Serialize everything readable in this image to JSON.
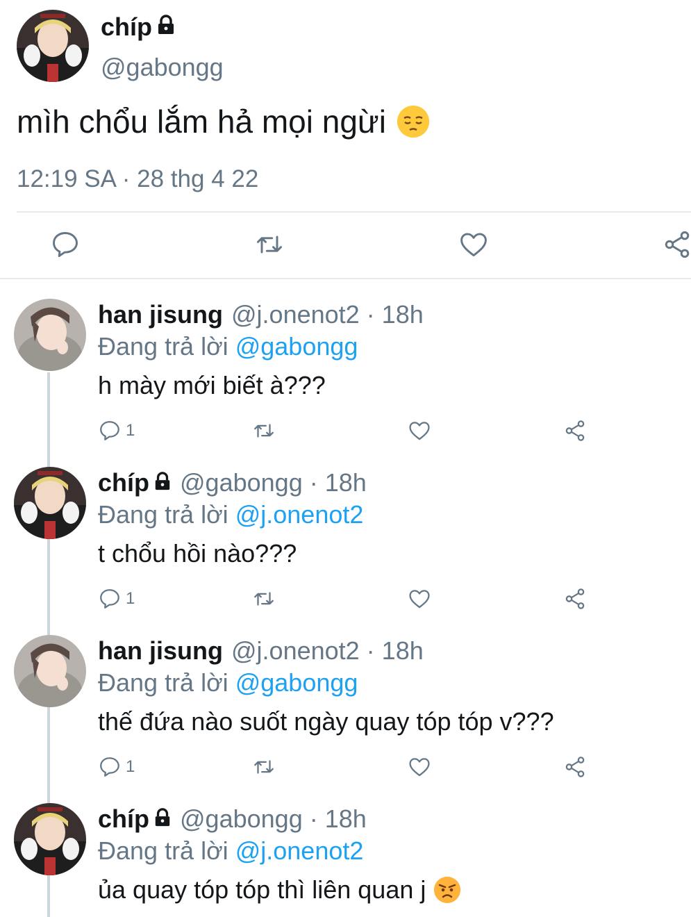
{
  "main_tweet": {
    "name": "chíp",
    "handle": "@gabongg",
    "text": "mìh chổu lắm hả mọi ngừi",
    "emoji": "pensive-face",
    "timestamp": "12:19 SA · 28 thg 4 22"
  },
  "replies": [
    {
      "name": "han jisung",
      "handle": "@j.onenot2 · 18h",
      "replying_label": "Đang trả lời",
      "replying_to": "@gabongg",
      "text": "h mày mới biết à???",
      "reply_count": "1",
      "locked": false
    },
    {
      "name": "chíp",
      "handle": "@gabongg · 18h",
      "replying_label": "Đang trả lời",
      "replying_to": "@j.onenot2",
      "text": "t chổu hồi nào???",
      "reply_count": "1",
      "locked": true
    },
    {
      "name": "han jisung",
      "handle": "@j.onenot2 · 18h",
      "replying_label": "Đang trả lời",
      "replying_to": "@gabongg",
      "text": "thế đứa nào suốt ngày quay tóp tóp v???",
      "reply_count": "1",
      "locked": false
    },
    {
      "name": "chíp",
      "handle": "@gabongg · 18h",
      "replying_label": "Đang trả lời",
      "replying_to": "@j.onenot2",
      "text": "ủa quay tóp tóp thì liên quan j",
      "emoji": "angry-face",
      "locked": true
    }
  ],
  "colors": {
    "text": "#14171a",
    "secondary": "#657786",
    "link": "#1da1f2",
    "divider": "#e6ecf0",
    "thread_line": "#ccd6dd"
  },
  "icons": [
    "reply-icon",
    "retweet-icon",
    "like-icon",
    "share-icon",
    "lock-icon"
  ]
}
